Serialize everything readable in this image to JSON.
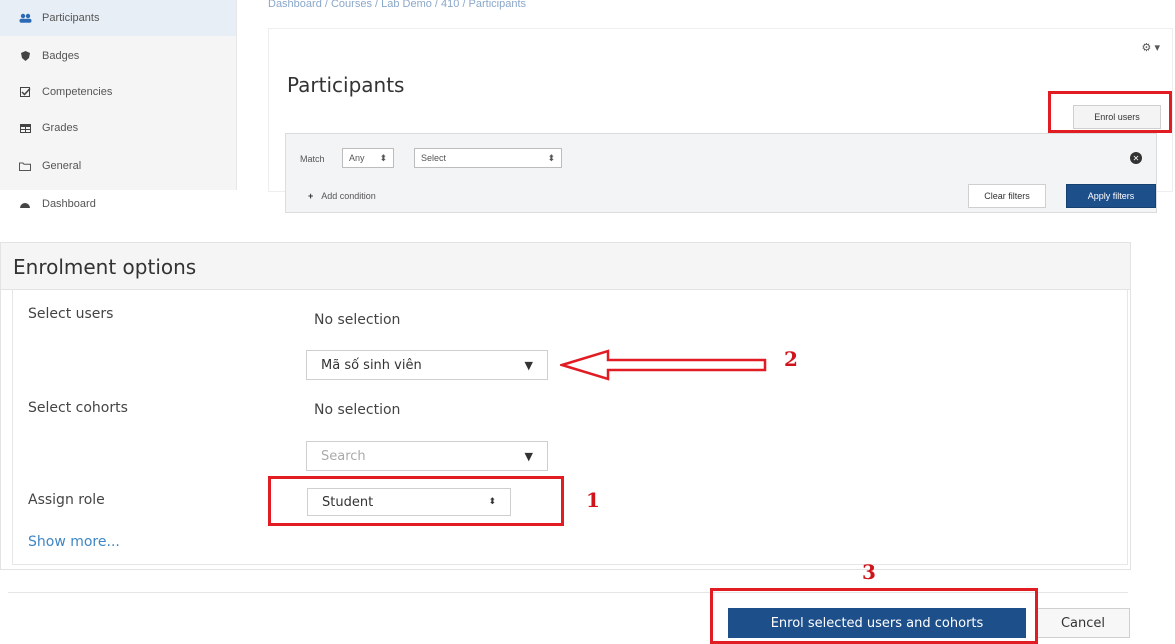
{
  "sidebar": {
    "items": [
      {
        "label": "Participants",
        "icon": "users-icon"
      },
      {
        "label": "Badges",
        "icon": "shield-icon"
      },
      {
        "label": "Competencies",
        "icon": "checkbox-icon"
      },
      {
        "label": "Grades",
        "icon": "table-icon"
      },
      {
        "label": "General",
        "icon": "folder-icon"
      },
      {
        "label": "Dashboard",
        "icon": "dashboard-icon"
      }
    ]
  },
  "breadcrumb": "Dashboard / Courses / Lab Demo / 410 / Participants",
  "participants": {
    "title": "Participants",
    "gear_caret": "▾",
    "enrol_users_label": "Enrol users",
    "filter": {
      "match_label": "Match",
      "match_value": "Any",
      "select_value": "Select",
      "add_condition_label": "Add condition",
      "clear_filters_label": "Clear filters",
      "apply_filters_label": "Apply filters"
    }
  },
  "enrolment": {
    "title": "Enrolment options",
    "select_users_label": "Select users",
    "users_no_selection": "No selection",
    "users_dropdown_value": "Mã số sinh viên",
    "select_cohorts_label": "Select cohorts",
    "cohorts_no_selection": "No selection",
    "cohorts_search_placeholder": "Search",
    "assign_role_label": "Assign role",
    "role_value": "Student",
    "show_more_label": "Show more...",
    "enrol_button_label": "Enrol selected users and cohorts",
    "cancel_button_label": "Cancel"
  },
  "annotations": {
    "one": "1",
    "two": "2",
    "three": "3",
    "highlight_color": "#e21c23"
  },
  "colors": {
    "primary_button": "#1d4f8b",
    "link": "#3f86c4"
  }
}
